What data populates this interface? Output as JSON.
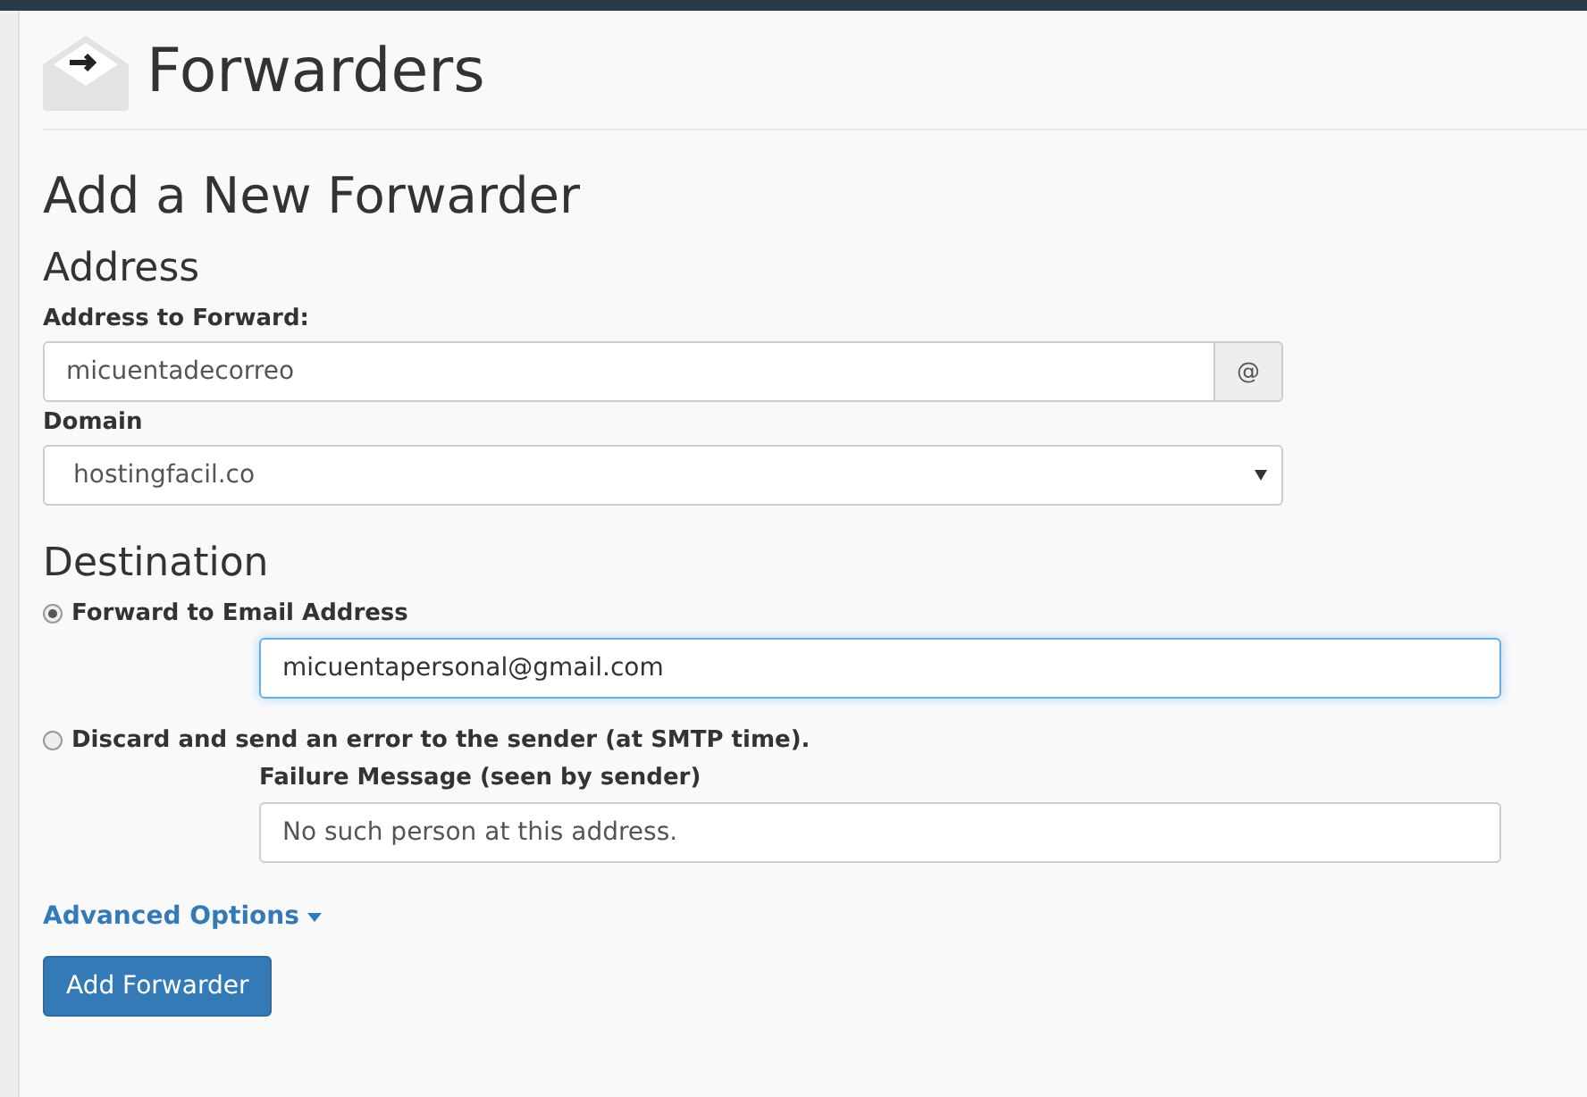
{
  "page": {
    "title": "Forwarders"
  },
  "form": {
    "heading": "Add a New Forwarder",
    "address_section": {
      "heading": "Address",
      "address_label": "Address to Forward:",
      "address_value": "micuentadecorreo",
      "addon": "@",
      "domain_label": "Domain",
      "domain_value": "hostingfacil.co"
    },
    "destination_section": {
      "heading": "Destination",
      "options": [
        {
          "label": "Forward to Email Address",
          "selected": true,
          "kind": "email",
          "value": "micuentapersonal@gmail.com"
        },
        {
          "label": "Discard and send an error to the sender (at SMTP time).",
          "selected": false,
          "kind": "fail",
          "field_label": "Failure Message (seen by sender)",
          "value": "No such person at this address."
        }
      ]
    },
    "advanced_link": "Advanced Options",
    "submit": "Add Forwarder"
  }
}
